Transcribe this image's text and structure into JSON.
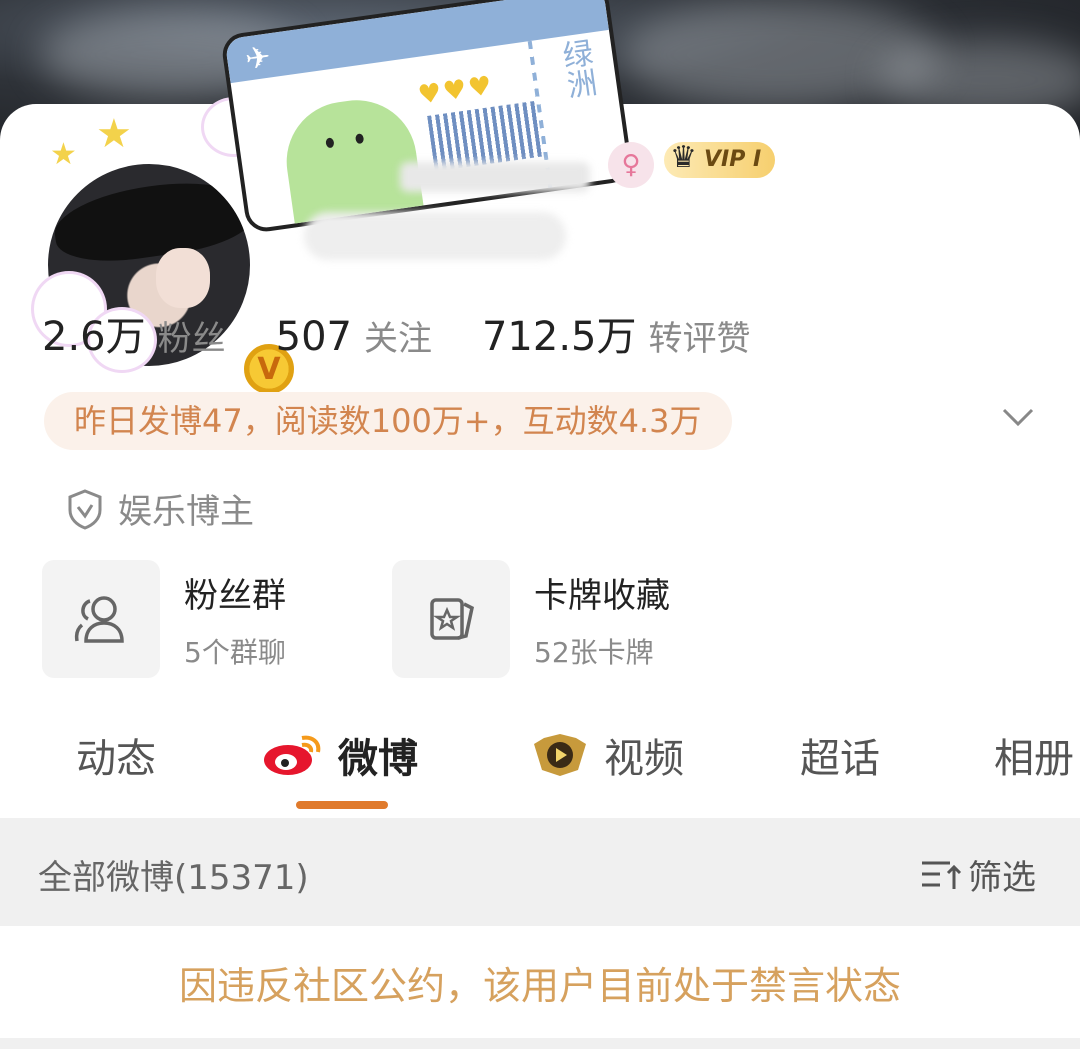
{
  "profile": {
    "vip_label": "VIP I",
    "pass_text": "绿洲",
    "gender_icon": "female-icon"
  },
  "stats": [
    {
      "value": "2.6万",
      "label": "粉丝"
    },
    {
      "value": "507",
      "label": "关注"
    },
    {
      "value": "712.5万",
      "label": "转评赞"
    }
  ],
  "summary": "昨日发博47，阅读数100万+，互动数4.3万",
  "tag": "娱乐博主",
  "entries": [
    {
      "title": "粉丝群",
      "subtitle": "5个群聊",
      "icon": "group-icon"
    },
    {
      "title": "卡牌收藏",
      "subtitle": "52张卡牌",
      "icon": "card-icon"
    }
  ],
  "tabs": [
    {
      "label": "动态"
    },
    {
      "label": "微博",
      "active": true
    },
    {
      "label": "视频"
    },
    {
      "label": "超话"
    },
    {
      "label": "相册"
    }
  ],
  "list": {
    "all_label": "全部微博(15371)",
    "filter_label": "筛选"
  },
  "notice": "因违反社区公约，该用户目前处于禁言状态",
  "colors": {
    "accent": "#e07a2c",
    "summary_text": "#d2854f",
    "notice_text": "#d6a15e"
  }
}
